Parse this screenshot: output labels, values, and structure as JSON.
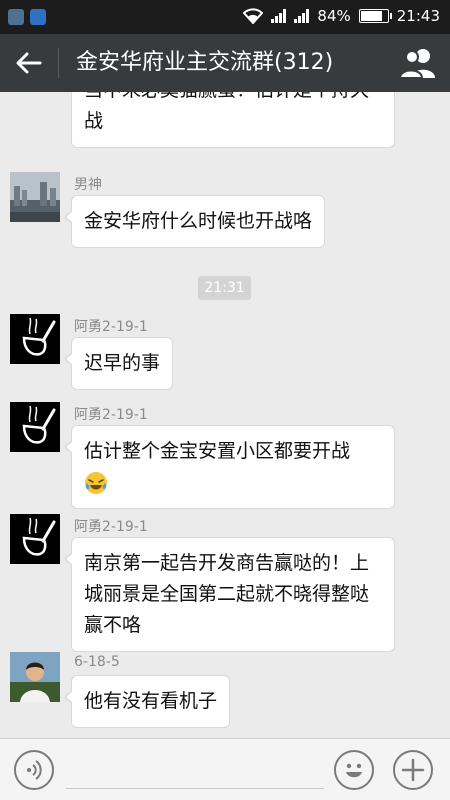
{
  "status_bar": {
    "battery": "84%",
    "battery_level": 0.84,
    "time": "21:43"
  },
  "header": {
    "title": "金安华府业主交流群(312)"
  },
  "messages": [
    {
      "text": "当中未必莫猫腻蛮！估计是个持久战"
    },
    {
      "sender": "男神",
      "text": "金安华府什么时候也开战咯"
    },
    {
      "time": "21:31"
    },
    {
      "sender": "阿勇2-19-1",
      "text": "迟早的事"
    },
    {
      "sender": "阿勇2-19-1",
      "text": "估计整个金宝安置小区都要开战",
      "emoji": "laugh-cry-emoji"
    },
    {
      "sender": "阿勇2-19-1",
      "text": "南京第一起告开发商告赢哒的！上城丽景是全国第二起就不晓得整哒赢不咯"
    },
    {
      "sender": "6-18-5",
      "text": "他有没有看机子"
    }
  ],
  "colors": {
    "title_bar": "#383b3e",
    "chat_bg": "#ebebeb",
    "status_bar": "#1c1c1c"
  }
}
